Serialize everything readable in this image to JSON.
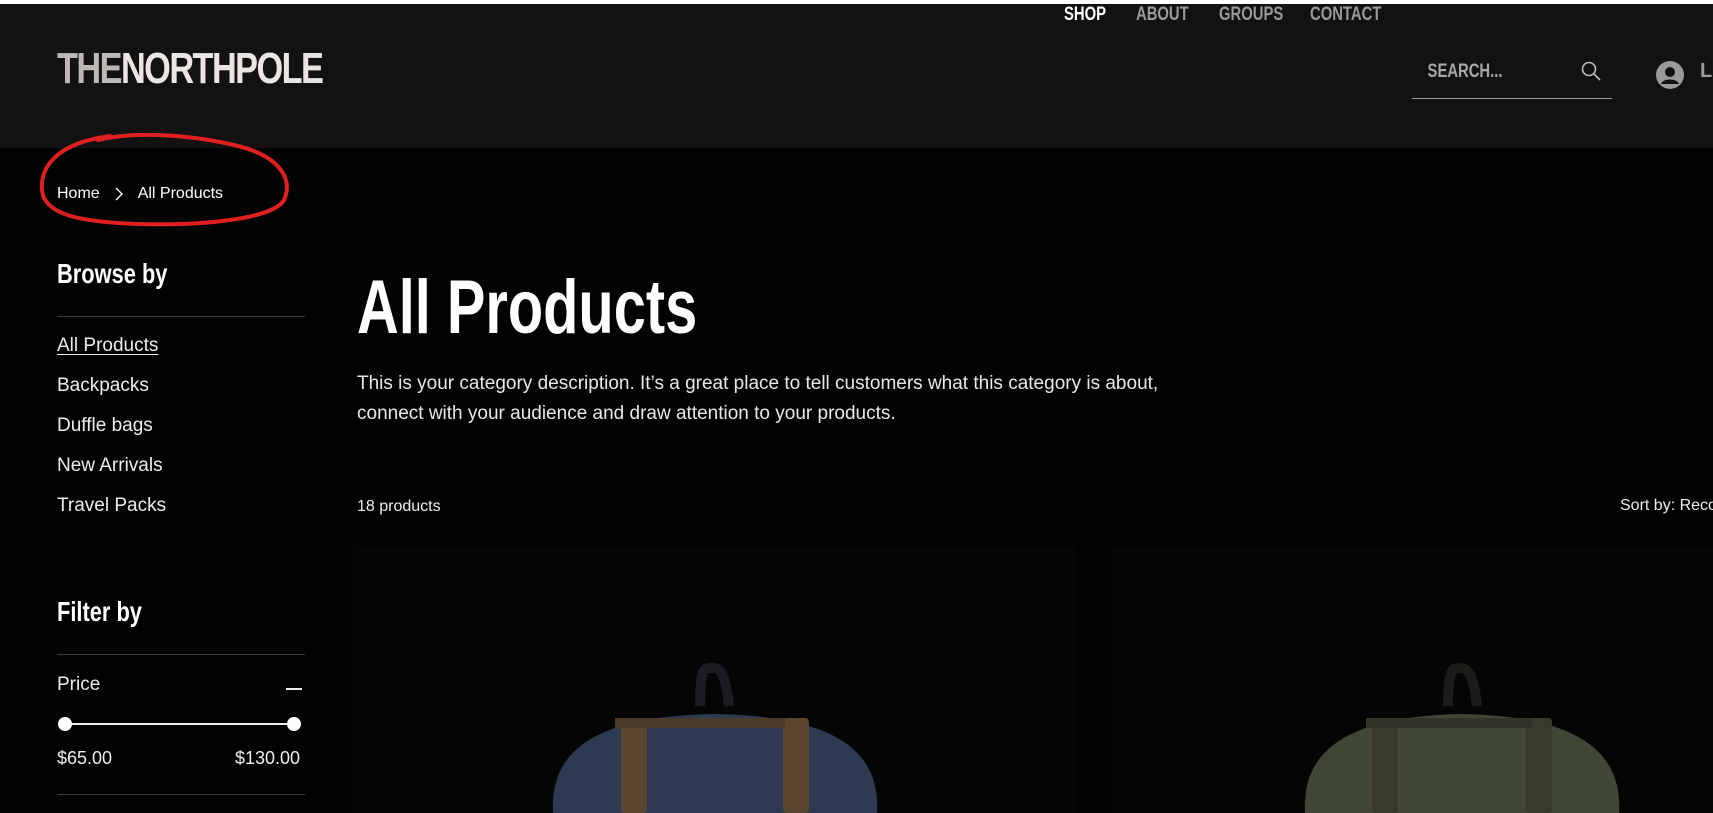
{
  "header": {
    "logo_prefix": "THE",
    "logo_main": "NORTHPOLE",
    "nav": [
      {
        "label": "SHOP",
        "active": true
      },
      {
        "label": "ABOUT",
        "active": false
      },
      {
        "label": "GROUPS",
        "active": false
      },
      {
        "label": "CONTACT",
        "active": false
      }
    ],
    "search": {
      "placeholder": "SEARCH...",
      "value": ""
    },
    "login_label": "L"
  },
  "breadcrumb": {
    "home": "Home",
    "current": "All Products"
  },
  "sidebar": {
    "browse_heading": "Browse by",
    "categories": [
      {
        "label": "All Products",
        "active": true
      },
      {
        "label": "Backpacks",
        "active": false
      },
      {
        "label": "Duffle bags",
        "active": false
      },
      {
        "label": "New Arrivals",
        "active": false
      },
      {
        "label": "Travel Packs",
        "active": false
      }
    ],
    "filter_heading": "Filter by",
    "price": {
      "label": "Price",
      "min": "$65.00",
      "max": "$130.00"
    }
  },
  "main": {
    "title": "All Products",
    "description": "This is your category description. It’s a great place to tell customers what this category is about, connect with your audience and draw attention to your products.",
    "product_count": "18 products",
    "sort_label": "Sort by: Reco"
  },
  "products": [
    {
      "color": "#2e3a52"
    },
    {
      "color": "#3f4636"
    }
  ],
  "colors": {
    "header_bg": "#121212",
    "page_bg": "#020202",
    "annotation": "#e02020",
    "strap": "#5a4630"
  }
}
